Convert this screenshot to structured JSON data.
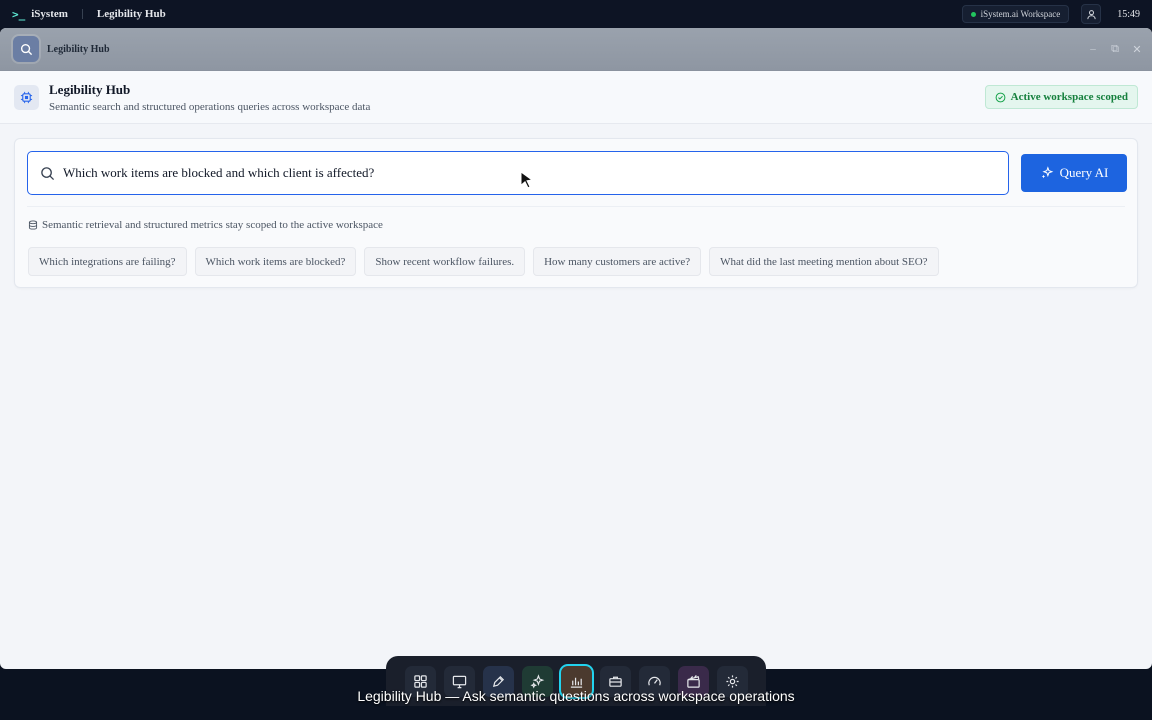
{
  "topbar": {
    "brand": "iSystem",
    "app_name": "Legibility Hub",
    "workspace": "iSystem.ai Workspace",
    "time": "15:49"
  },
  "window": {
    "title": "Legibility Hub"
  },
  "header": {
    "title": "Legibility Hub",
    "subtitle": "Semantic search and structured operations queries across workspace data",
    "badge": "Active workspace scoped"
  },
  "search": {
    "value": "Which work items are blocked and which client is affected?",
    "button_label": "Query AI",
    "scope_note": "Semantic retrieval and structured metrics stay scoped to the active workspace"
  },
  "suggestions": [
    "Which integrations are failing?",
    "Which work items are blocked?",
    "Show recent workflow failures.",
    "How many customers are active?",
    "What did the last meeting mention about SEO?"
  ],
  "dock": {
    "items": [
      "apps-icon",
      "monitor-icon",
      "pen-icon",
      "sparkles-icon",
      "chart-icon",
      "briefcase-icon",
      "gauge-icon",
      "clapperboard-icon",
      "settings-icon"
    ],
    "active": "chart-icon"
  },
  "caption": "Legibility Hub — Ask semantic questions across workspace operations",
  "colors": {
    "accent": "#1d64e0",
    "scope_green": "#15803d",
    "dock_active_ring": "#22d3ee"
  }
}
